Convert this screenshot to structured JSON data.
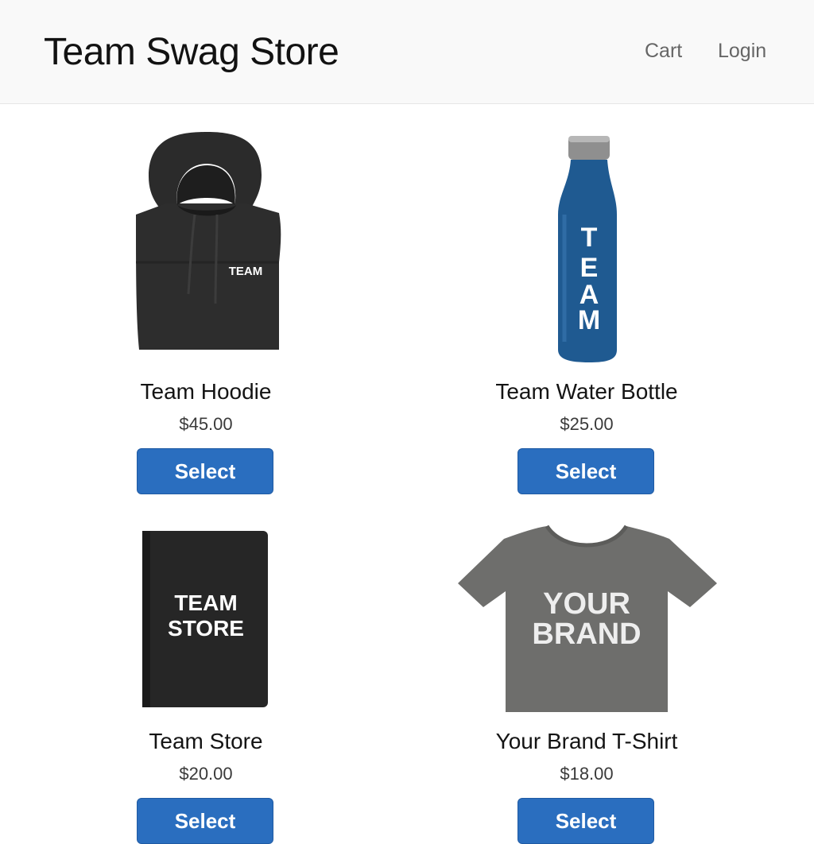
{
  "header": {
    "title": "Team Swag Store",
    "nav": {
      "cart": "Cart",
      "login": "Login"
    }
  },
  "products": [
    {
      "name": "Team Hoodie",
      "price": "$45.00",
      "button": "Select",
      "print": "TEAM",
      "icon": "hoodie-image",
      "color": "#2b2b2b"
    },
    {
      "name": "Team Water Bottle",
      "price": "$25.00",
      "button": "Select",
      "print": "TEAM",
      "icon": "water-bottle-image",
      "color": "#1f5a91"
    },
    {
      "name": "Team Store",
      "price": "$20.00",
      "button": "Select",
      "print_line1": "TEAM",
      "print_line2": "STORE",
      "icon": "notebook-image",
      "color": "#262626"
    },
    {
      "name": "Your Brand T-Shirt",
      "price": "$18.00",
      "button": "Select",
      "print_line1": "YOUR",
      "print_line2": "BRAND",
      "icon": "tshirt-image",
      "color": "#6e6e6c"
    }
  ],
  "colors": {
    "accent": "#2a6ebf",
    "header_bg": "#f9f9f9"
  }
}
